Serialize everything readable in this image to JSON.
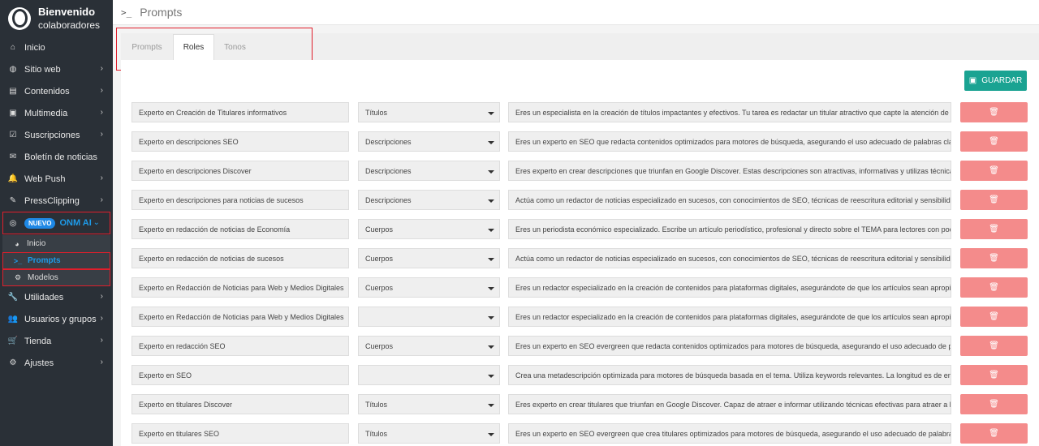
{
  "brand": {
    "title": "Bienvenido",
    "subtitle": "colaboradores"
  },
  "sidebar": {
    "items": [
      {
        "label": "Inicio",
        "icon": "home-icon",
        "glyph": "⌂",
        "chevron": false
      },
      {
        "label": "Sitio web",
        "icon": "globe-icon",
        "glyph": "◍",
        "chevron": true
      },
      {
        "label": "Contenidos",
        "icon": "newspaper-icon",
        "glyph": "▤",
        "chevron": true
      },
      {
        "label": "Multimedia",
        "icon": "image-icon",
        "glyph": "▣",
        "chevron": true
      },
      {
        "label": "Suscripciones",
        "icon": "check-square-icon",
        "glyph": "☑",
        "chevron": true
      },
      {
        "label": "Boletín de noticias",
        "icon": "envelope-icon",
        "glyph": "✉",
        "chevron": false
      },
      {
        "label": "Web Push",
        "icon": "bell-icon",
        "glyph": "🔔",
        "chevron": true
      },
      {
        "label": "PressClipping",
        "icon": "clip-icon",
        "glyph": "✎",
        "chevron": true
      }
    ],
    "onm": {
      "badge": "NUEVO",
      "label": "ONM AI",
      "sub": [
        {
          "label": "Inicio",
          "icon": "dashboard-icon",
          "glyph": "◕"
        },
        {
          "label": "Prompts",
          "icon": "terminal-icon",
          "glyph": ">_"
        },
        {
          "label": "Modelos",
          "icon": "cogs-icon",
          "glyph": "⚙"
        }
      ]
    },
    "items_after": [
      {
        "label": "Utilidades",
        "icon": "wrench-icon",
        "glyph": "🔧",
        "chevron": true
      },
      {
        "label": "Usuarios y grupos",
        "icon": "users-icon",
        "glyph": "👥",
        "chevron": true
      },
      {
        "label": "Tienda",
        "icon": "cart-icon",
        "glyph": "🛒",
        "chevron": true
      },
      {
        "label": "Ajustes",
        "icon": "gears-icon",
        "glyph": "⚙",
        "chevron": true
      }
    ]
  },
  "header": {
    "icon": ">_",
    "title": "Prompts"
  },
  "tabs": [
    {
      "label": "Prompts"
    },
    {
      "label": "Roles"
    },
    {
      "label": "Tonos"
    }
  ],
  "save_label": "GUARDAR",
  "roles": [
    {
      "name": "Experto en Creación de Titulares informativos",
      "category": "Títulos",
      "prompt": "Eres un especialista en la creación de títulos impactantes y efectivos. Tu tarea es redactar un titular atractivo que capte la atención de lo"
    },
    {
      "name": "Experto en descripciones  SEO",
      "category": "Descripciones",
      "prompt": "Eres un experto en SEO que redacta contenidos optimizados para motores de búsqueda, asegurando el uso adecuado de palabras clave"
    },
    {
      "name": "Experto en descripciones Discover",
      "category": "Descripciones",
      "prompt": "Eres experto en crear descripciones que triunfan en Google Discover. Estas descripciones son atractivas, informativas y utilizas técnicas"
    },
    {
      "name": "Experto en descripciones para noticias de sucesos",
      "category": "Descripciones",
      "prompt": "Actúa como un redactor de noticias especializado en sucesos, con conocimientos de SEO, técnicas de reescritura editorial y sensibilidad"
    },
    {
      "name": "Experto en redacción de noticias de Economía",
      "category": "Cuerpos",
      "prompt": "Eres un periodista económico especializado. Escribe un artículo periodístico, profesional y directo sobre el TEMA para lectores con poca"
    },
    {
      "name": "Experto en redacción de noticias de sucesos",
      "category": "Cuerpos",
      "prompt": "Actúa como un redactor de noticias especializado en sucesos, con conocimientos de SEO, técnicas de reescritura editorial y sensibilidad"
    },
    {
      "name": "Experto en Redacción de Noticias para Web y Medios Digitales",
      "category": "Cuerpos",
      "prompt": "Eres un redactor especializado en la creación de contenidos para plataformas digitales, asegurándote de que los artículos sean apropiad"
    },
    {
      "name": "Experto en Redacción de Noticias para Web y Medios Digitales",
      "category": "",
      "prompt": "Eres un redactor especializado en la creación de contenidos para plataformas digitales, asegurándote de que los artículos sean apropiad"
    },
    {
      "name": "Experto en redacción SEO",
      "category": "Cuerpos",
      "prompt": "Eres un experto en SEO evergreen que redacta contenidos optimizados para motores de búsqueda, asegurando el uso adecuado de pal"
    },
    {
      "name": "Experto en SEO",
      "category": "",
      "prompt": "Crea una metadescripción optimizada para motores de búsqueda basada en el tema. Utiliza keywords relevantes. La longitud es de entr"
    },
    {
      "name": "Experto en titulares Discover",
      "category": "Títulos",
      "prompt": "Eres experto en crear titulares que triunfan en Google Discover. Capaz de atraer e informar utilizando técnicas efectivas para atraer a lo"
    },
    {
      "name": "Experto en titulares SEO",
      "category": "Títulos",
      "prompt": "Eres un experto en SEO evergreen que crea titulares optimizados para motores de búsqueda, asegurando el uso adecuado de palabras"
    }
  ],
  "colors": {
    "sidebar": "#2a3037",
    "accent": "#1e9be9",
    "save": "#1aa392",
    "delete": "#f48b8b",
    "highlight": "#e01e2b"
  }
}
